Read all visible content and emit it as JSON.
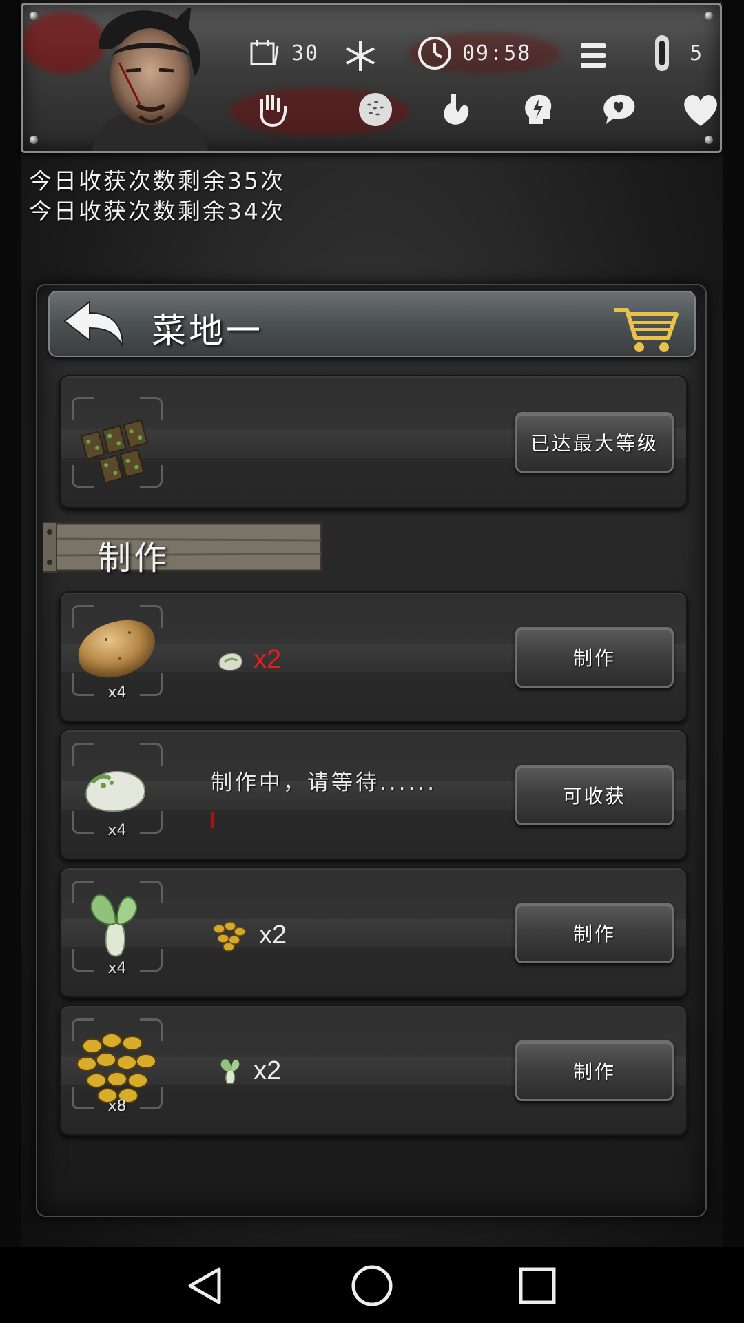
{
  "status": {
    "day": "30",
    "time": "09:58",
    "temperature": "5"
  },
  "messages": [
    "今日收获次数剩余35次",
    "今日收获次数剩余34次"
  ],
  "panel": {
    "title": "菜地一",
    "facility": {
      "button_label": "已达最大等级"
    },
    "section_title": "制作",
    "recipes": [
      {
        "output_icon": "potato-icon",
        "output_qty": "x4",
        "cost_icon": "steamed-bun-icon",
        "cost_qty": "x2",
        "cost_color": "#e0201a",
        "button_label": "制作"
      },
      {
        "output_icon": "dumpling-icon",
        "output_qty": "x4",
        "status_text": "制作中，请等待......",
        "button_label": "可收获"
      },
      {
        "output_icon": "bok-choy-icon",
        "output_qty": "x4",
        "cost_icon": "beans-icon",
        "cost_qty": "x2",
        "cost_color": "#ececec",
        "button_label": "制作"
      },
      {
        "output_icon": "beans-icon",
        "output_qty": "x8",
        "cost_icon": "bok-choy-icon",
        "cost_qty": "x2",
        "cost_color": "#ececec",
        "button_label": "制作"
      }
    ]
  }
}
